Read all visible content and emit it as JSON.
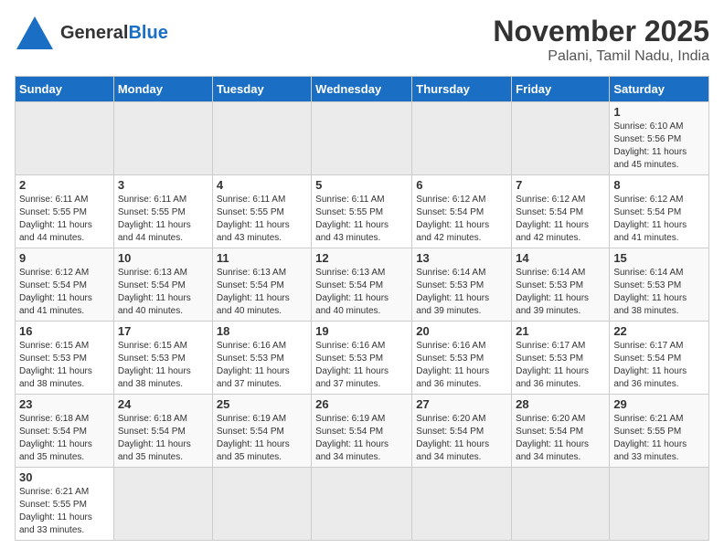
{
  "header": {
    "logo_general": "General",
    "logo_blue": "Blue",
    "month_title": "November 2025",
    "location": "Palani, Tamil Nadu, India"
  },
  "days_of_week": [
    "Sunday",
    "Monday",
    "Tuesday",
    "Wednesday",
    "Thursday",
    "Friday",
    "Saturday"
  ],
  "weeks": [
    [
      {
        "day": "",
        "empty": true
      },
      {
        "day": "",
        "empty": true
      },
      {
        "day": "",
        "empty": true
      },
      {
        "day": "",
        "empty": true
      },
      {
        "day": "",
        "empty": true
      },
      {
        "day": "",
        "empty": true
      },
      {
        "day": "1",
        "sunrise": "6:10 AM",
        "sunset": "5:56 PM",
        "hours": "11",
        "minutes": "45"
      }
    ],
    [
      {
        "day": "2",
        "sunrise": "6:11 AM",
        "sunset": "5:55 PM",
        "hours": "11",
        "minutes": "44"
      },
      {
        "day": "3",
        "sunrise": "6:11 AM",
        "sunset": "5:55 PM",
        "hours": "11",
        "minutes": "44"
      },
      {
        "day": "4",
        "sunrise": "6:11 AM",
        "sunset": "5:55 PM",
        "hours": "11",
        "minutes": "43"
      },
      {
        "day": "5",
        "sunrise": "6:11 AM",
        "sunset": "5:55 PM",
        "hours": "11",
        "minutes": "43"
      },
      {
        "day": "6",
        "sunrise": "6:12 AM",
        "sunset": "5:54 PM",
        "hours": "11",
        "minutes": "42"
      },
      {
        "day": "7",
        "sunrise": "6:12 AM",
        "sunset": "5:54 PM",
        "hours": "11",
        "minutes": "42"
      },
      {
        "day": "8",
        "sunrise": "6:12 AM",
        "sunset": "5:54 PM",
        "hours": "11",
        "minutes": "41"
      }
    ],
    [
      {
        "day": "9",
        "sunrise": "6:12 AM",
        "sunset": "5:54 PM",
        "hours": "11",
        "minutes": "41"
      },
      {
        "day": "10",
        "sunrise": "6:13 AM",
        "sunset": "5:54 PM",
        "hours": "11",
        "minutes": "40"
      },
      {
        "day": "11",
        "sunrise": "6:13 AM",
        "sunset": "5:54 PM",
        "hours": "11",
        "minutes": "40"
      },
      {
        "day": "12",
        "sunrise": "6:13 AM",
        "sunset": "5:54 PM",
        "hours": "11",
        "minutes": "40"
      },
      {
        "day": "13",
        "sunrise": "6:14 AM",
        "sunset": "5:53 PM",
        "hours": "11",
        "minutes": "39"
      },
      {
        "day": "14",
        "sunrise": "6:14 AM",
        "sunset": "5:53 PM",
        "hours": "11",
        "minutes": "39"
      },
      {
        "day": "15",
        "sunrise": "6:14 AM",
        "sunset": "5:53 PM",
        "hours": "11",
        "minutes": "38"
      }
    ],
    [
      {
        "day": "16",
        "sunrise": "6:15 AM",
        "sunset": "5:53 PM",
        "hours": "11",
        "minutes": "38"
      },
      {
        "day": "17",
        "sunrise": "6:15 AM",
        "sunset": "5:53 PM",
        "hours": "11",
        "minutes": "38"
      },
      {
        "day": "18",
        "sunrise": "6:16 AM",
        "sunset": "5:53 PM",
        "hours": "11",
        "minutes": "37"
      },
      {
        "day": "19",
        "sunrise": "6:16 AM",
        "sunset": "5:53 PM",
        "hours": "11",
        "minutes": "37"
      },
      {
        "day": "20",
        "sunrise": "6:16 AM",
        "sunset": "5:53 PM",
        "hours": "11",
        "minutes": "36"
      },
      {
        "day": "21",
        "sunrise": "6:17 AM",
        "sunset": "5:53 PM",
        "hours": "11",
        "minutes": "36"
      },
      {
        "day": "22",
        "sunrise": "6:17 AM",
        "sunset": "5:54 PM",
        "hours": "11",
        "minutes": "36"
      }
    ],
    [
      {
        "day": "23",
        "sunrise": "6:18 AM",
        "sunset": "5:54 PM",
        "hours": "11",
        "minutes": "35"
      },
      {
        "day": "24",
        "sunrise": "6:18 AM",
        "sunset": "5:54 PM",
        "hours": "11",
        "minutes": "35"
      },
      {
        "day": "25",
        "sunrise": "6:19 AM",
        "sunset": "5:54 PM",
        "hours": "11",
        "minutes": "35"
      },
      {
        "day": "26",
        "sunrise": "6:19 AM",
        "sunset": "5:54 PM",
        "hours": "11",
        "minutes": "34"
      },
      {
        "day": "27",
        "sunrise": "6:20 AM",
        "sunset": "5:54 PM",
        "hours": "11",
        "minutes": "34"
      },
      {
        "day": "28",
        "sunrise": "6:20 AM",
        "sunset": "5:54 PM",
        "hours": "11",
        "minutes": "34"
      },
      {
        "day": "29",
        "sunrise": "6:21 AM",
        "sunset": "5:55 PM",
        "hours": "11",
        "minutes": "33"
      }
    ],
    [
      {
        "day": "30",
        "sunrise": "6:21 AM",
        "sunset": "5:55 PM",
        "hours": "11",
        "minutes": "33"
      },
      {
        "day": "",
        "empty": true
      },
      {
        "day": "",
        "empty": true
      },
      {
        "day": "",
        "empty": true
      },
      {
        "day": "",
        "empty": true
      },
      {
        "day": "",
        "empty": true
      },
      {
        "day": "",
        "empty": true
      }
    ]
  ],
  "labels": {
    "sunrise": "Sunrise:",
    "sunset": "Sunset:",
    "daylight": "Daylight:",
    "hours_suffix": "hours",
    "and": "and",
    "minutes_suffix": "minutes."
  }
}
